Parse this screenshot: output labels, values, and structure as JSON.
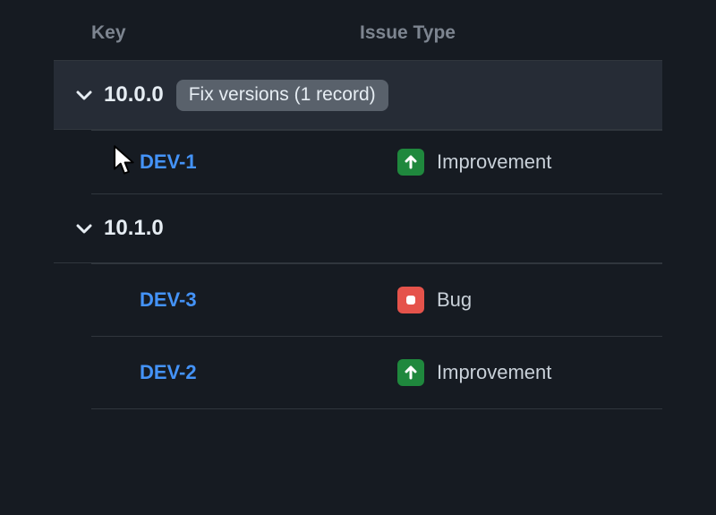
{
  "columns": {
    "key": "Key",
    "type": "Issue Type"
  },
  "groups": [
    {
      "title": "10.0.0",
      "hovered": true,
      "pill_text": "Fix versions (1 record)",
      "rows": [
        {
          "key": "DEV-1",
          "type_label": "Improvement",
          "type_kind": "improvement"
        }
      ]
    },
    {
      "title": "10.1.0",
      "hovered": false,
      "pill_text": "",
      "rows": [
        {
          "key": "DEV-3",
          "type_label": "Bug",
          "type_kind": "bug"
        },
        {
          "key": "DEV-2",
          "type_label": "Improvement",
          "type_kind": "improvement"
        }
      ]
    }
  ]
}
